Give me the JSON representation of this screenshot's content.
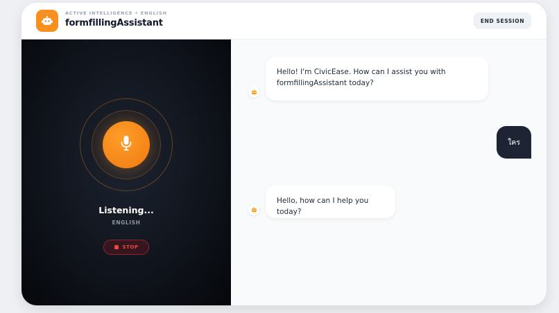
{
  "header": {
    "subtitle": "ACTIVE INTELLIGENCE • ENGLISH",
    "title": "formfillingAssistant",
    "end_session_label": "END SESSION",
    "logo_icon": "robot-icon"
  },
  "voice_panel": {
    "status": "Listening...",
    "language": "ENGLISH",
    "stop_label": "STOP",
    "mic_icon": "microphone-icon",
    "accent_color": "#f7901e"
  },
  "chat": {
    "messages": [
      {
        "role": "assistant",
        "text": "Hello! I'm CivicEase. How can I assist you with formfillingAssistant today?"
      },
      {
        "role": "user",
        "text": "ใคร"
      },
      {
        "role": "assistant",
        "text": "Hello, how can I help you today?"
      }
    ]
  }
}
